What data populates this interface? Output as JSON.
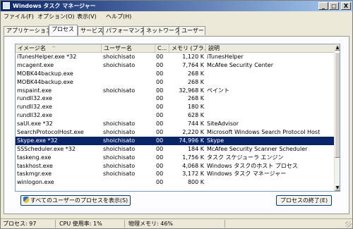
{
  "window": {
    "title": "Windows タスク マネージャー",
    "controls": {
      "minimize": "_",
      "maximize": "□",
      "close": "X"
    }
  },
  "menu": [
    {
      "label": "ファイル(F)"
    },
    {
      "label": "オプション(O)"
    },
    {
      "label": "表示(V)"
    },
    {
      "label": "ヘルプ(H)"
    }
  ],
  "tabs": [
    {
      "label": "アプリケーション",
      "active": false
    },
    {
      "label": "プロセス",
      "active": true
    },
    {
      "label": "サービス",
      "active": false
    },
    {
      "label": "パフォーマンス",
      "active": false
    },
    {
      "label": "ネットワーク",
      "active": false
    },
    {
      "label": "ユーザー",
      "active": false
    }
  ],
  "process_list": {
    "columns": {
      "name": "イメージ名",
      "user": "ユーザー名",
      "cpu": "C...",
      "memory": "メモリ (プラ...",
      "description": "説明"
    },
    "sort_indicator": "^",
    "rows": [
      {
        "name": "iTunesHelper.exe *32",
        "user": "shoichisato",
        "cpu": "00",
        "memory": "1,120 K",
        "description": "iTunesHelper",
        "selected": false
      },
      {
        "name": "mcagent.exe",
        "user": "shoichisato",
        "cpu": "00",
        "memory": "7,764 K",
        "description": "McAfee Security Center",
        "selected": false
      },
      {
        "name": "MOBK44backup.exe",
        "user": "",
        "cpu": "00",
        "memory": "268 K",
        "description": "",
        "selected": false
      },
      {
        "name": "MOBK44backup.exe",
        "user": "",
        "cpu": "00",
        "memory": "268 K",
        "description": "",
        "selected": false
      },
      {
        "name": "mspaint.exe",
        "user": "shoichisato",
        "cpu": "00",
        "memory": "32,968 K",
        "description": "ペイント",
        "selected": false
      },
      {
        "name": "rundll32.exe",
        "user": "",
        "cpu": "00",
        "memory": "268 K",
        "description": "",
        "selected": false
      },
      {
        "name": "rundll32.exe",
        "user": "",
        "cpu": "00",
        "memory": "180 K",
        "description": "",
        "selected": false
      },
      {
        "name": "rundll32.exe",
        "user": "",
        "cpu": "00",
        "memory": "628 K",
        "description": "",
        "selected": false
      },
      {
        "name": "saUI.exe *32",
        "user": "shoichisato",
        "cpu": "00",
        "memory": "744 K",
        "description": "SiteAdvisor",
        "selected": false
      },
      {
        "name": "SearchProtocolHost.exe",
        "user": "shoichisato",
        "cpu": "00",
        "memory": "2,220 K",
        "description": "Microsoft Windows Search Protocol Host",
        "selected": false
      },
      {
        "name": "Skype.exe *32",
        "user": "shoichisato",
        "cpu": "00",
        "memory": "74,996 K",
        "description": "Skype",
        "selected": true
      },
      {
        "name": "SSScheduler.exe *32",
        "user": "shoichisato",
        "cpu": "00",
        "memory": "184 K",
        "description": "McAfee Security Scanner Scheduler",
        "selected": false
      },
      {
        "name": "taskeng.exe",
        "user": "shoichisato",
        "cpu": "00",
        "memory": "1,756 K",
        "description": "タスク スケジューラ エンジン",
        "selected": false
      },
      {
        "name": "taskhost.exe",
        "user": "shoichisato",
        "cpu": "00",
        "memory": "4,068 K",
        "description": "Windows タスクのホスト プロセス",
        "selected": false
      },
      {
        "name": "taskmgr.exe",
        "user": "shoichisato",
        "cpu": "00",
        "memory": "3,172 K",
        "description": "Windows タスク マネージャー",
        "selected": false
      },
      {
        "name": "winlogon.exe",
        "user": "",
        "cpu": "00",
        "memory": "800 K",
        "description": "",
        "selected": false
      }
    ]
  },
  "buttons": {
    "show_all": "すべてのユーザーのプロセスを表示(S)",
    "end_process": "プロセスの終了(E)"
  },
  "statusbar": {
    "processes": "プロセス: 97",
    "cpu": "CPU 使用率: 1%",
    "memory": "物理メモリ: 46%"
  },
  "colors": {
    "selection": "#0a246a",
    "titlebar_start": "#0a246a",
    "titlebar_end": "#a6caf0"
  },
  "icons": [
    "app-icon",
    "shield-icon",
    "sort-arrow-icon",
    "scroll-up-icon",
    "scroll-down-icon",
    "size-grip-icon"
  ]
}
